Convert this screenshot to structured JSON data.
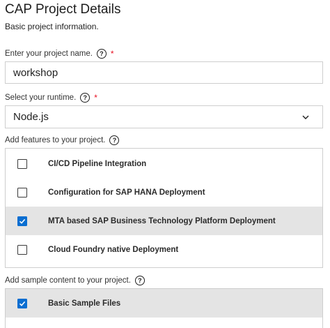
{
  "header": {
    "title": "CAP Project Details",
    "subtitle": "Basic project information."
  },
  "project_name": {
    "label": "Enter your project name.",
    "required_marker": "*",
    "help_icon": "question-circle-icon",
    "value": "workshop"
  },
  "runtime": {
    "label": "Select your runtime.",
    "required_marker": "*",
    "help_icon": "question-circle-icon",
    "selected": "Node.js",
    "dropdown_icon": "chevron-down-icon"
  },
  "features": {
    "label": "Add features to your project.",
    "help_icon": "question-circle-icon",
    "items": [
      {
        "label": "CI/CD Pipeline Integration",
        "checked": false
      },
      {
        "label": "Configuration for SAP HANA Deployment",
        "checked": false
      },
      {
        "label": "MTA based SAP Business Technology Platform Deployment",
        "checked": true
      },
      {
        "label": "Cloud Foundry native Deployment",
        "checked": false
      }
    ]
  },
  "samples": {
    "label": "Add sample content to your project.",
    "help_icon": "question-circle-icon",
    "items": [
      {
        "label": "Basic Sample Files",
        "checked": true
      }
    ]
  },
  "colors": {
    "checkbox_checked": "#0a6ed1",
    "selected_row_bg": "#e4e4e4",
    "required_star": "#e81123"
  }
}
